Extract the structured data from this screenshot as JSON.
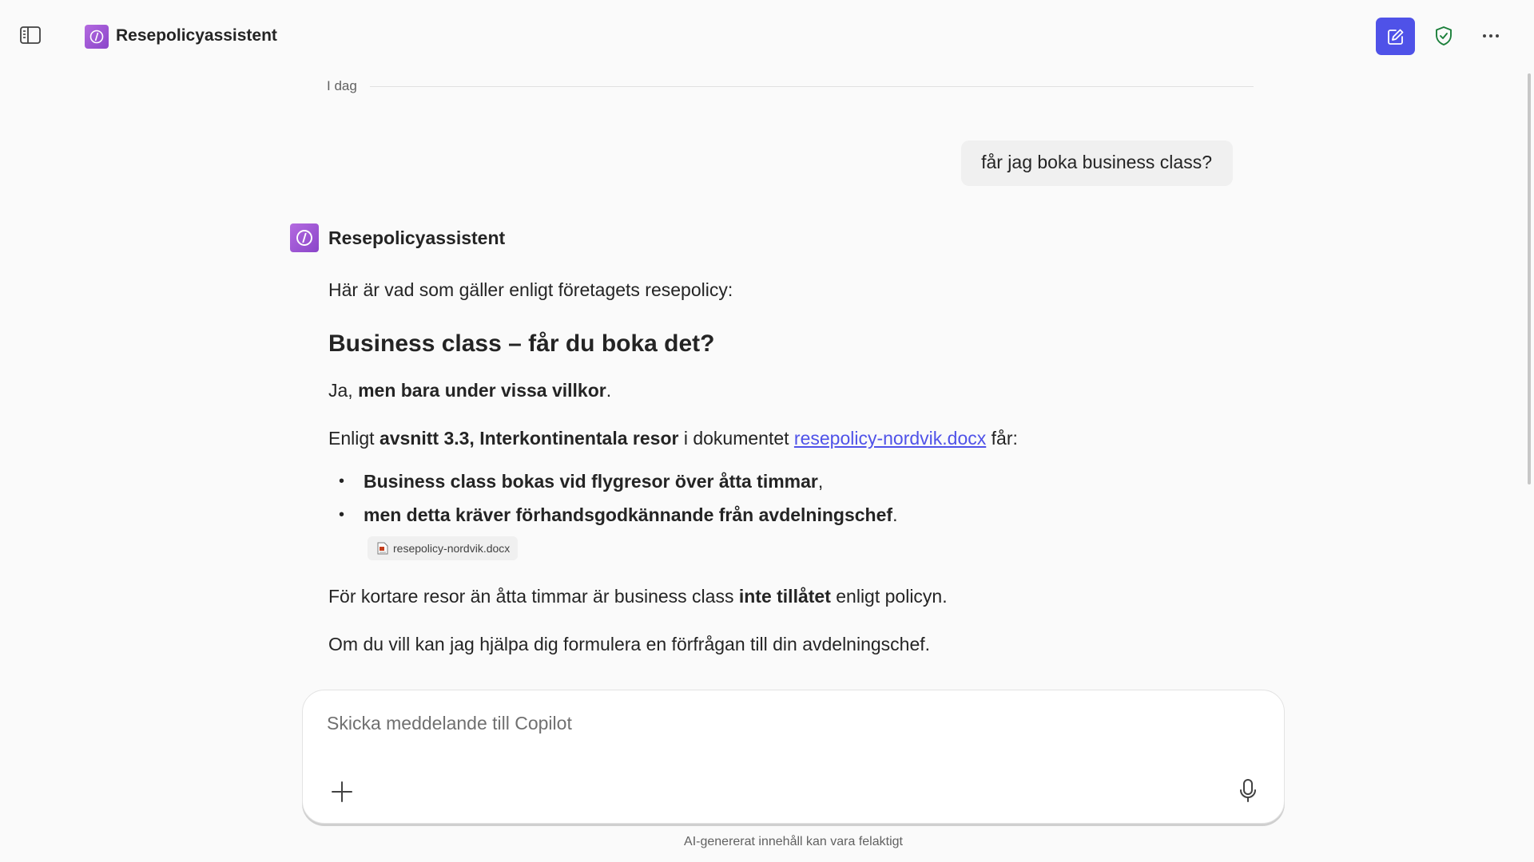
{
  "header": {
    "app_title": "Resepolicyassistent",
    "icons": {
      "sidebar_toggle": "sidebar-panel-icon",
      "app_logo": "code-bracket-logo-icon",
      "new_chat": "compose-icon",
      "shield": "shield-check-icon",
      "more": "more-horizontal-icon"
    }
  },
  "conversation": {
    "date_label": "I dag",
    "user_message": "får jag boka business class?",
    "assistant": {
      "name": "Resepolicyassistent",
      "intro": "Här är vad som gäller enligt företagets resepolicy:",
      "heading": "Business class – får du boka det?",
      "p1_prefix": "Ja, ",
      "p1_bold": "men bara under vissa villkor",
      "p1_suffix": ".",
      "p2_prefix": "Enligt ",
      "p2_bold": "avsnitt 3.3, Interkontinentala resor",
      "p2_middle": " i dokumentet ",
      "p2_link": "resepolicy-nordvik.docx",
      "p2_suffix": " får:",
      "bullets": [
        {
          "bold": "Business class bokas vid flygresor över åtta timmar",
          "suffix": ","
        },
        {
          "bold": "men detta kräver förhandsgodkännande från avdelningschef",
          "suffix": "."
        }
      ],
      "citation": "resepolicy-nordvik.docx",
      "p3_prefix": "För kortare resor än åtta timmar är business class ",
      "p3_bold": "inte tillåtet",
      "p3_suffix": " enligt policyn.",
      "p4": "Om du vill kan jag hjälpa dig formulera en förfrågan till din avdelningschef."
    }
  },
  "composer": {
    "placeholder": "Skicka meddelande till Copilot",
    "value": "",
    "icons": {
      "add": "plus-icon",
      "mic": "microphone-icon"
    }
  },
  "footer": {
    "disclaimer": "AI-genererat innehåll kan vara felaktigt"
  },
  "colors": {
    "accent": "#4f52e8",
    "logo_purple": "#a55bd8",
    "shield_green": "#1b7f3a",
    "background": "#fafafa"
  }
}
